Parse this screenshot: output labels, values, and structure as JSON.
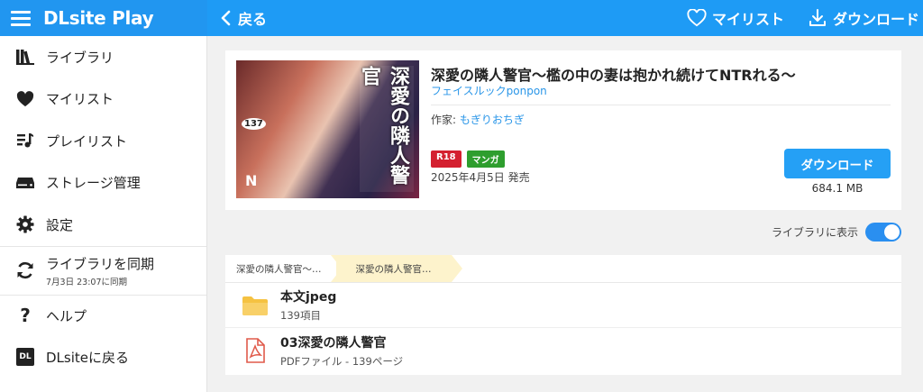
{
  "app": {
    "logo": "DLsite Play",
    "back_label": "戻る",
    "mylist_label": "マイリスト",
    "download_label": "ダウンロード"
  },
  "sidebar": {
    "items": [
      {
        "label": "ライブラリ",
        "icon": "library-icon"
      },
      {
        "label": "マイリスト",
        "icon": "heart-icon"
      },
      {
        "label": "プレイリスト",
        "icon": "playlist-icon"
      },
      {
        "label": "ストレージ管理",
        "icon": "storage-icon"
      },
      {
        "label": "設定",
        "icon": "gear-icon"
      }
    ],
    "sync": {
      "label": "ライブラリを同期",
      "sub": "7月3日 23:07に同期"
    },
    "help": "ヘルプ",
    "back_dlsite": "DLsiteに戻る",
    "back_dlsite_badge": "DL"
  },
  "work": {
    "title": "深愛の隣人警官〜檻の中の妻は抱かれ続けてNTRれる〜",
    "circle": "フェイスルックponpon",
    "author_label": "作家: ",
    "author": "もぎりおちぎ",
    "tags": [
      "R18",
      "マンガ"
    ],
    "release": "2025年4月5日 発売",
    "download_button": "ダウンロード",
    "size": "684.1 MB",
    "cover_text": [
      "深愛の隣人警官",
      "137",
      "N"
    ]
  },
  "library_toggle": {
    "label": "ライブラリに表示",
    "on": true
  },
  "files": {
    "breadcrumb": [
      "深愛の隣人警官〜…",
      "深愛の隣人警官…"
    ],
    "items": [
      {
        "name": "本文jpeg",
        "meta": "139項目",
        "icon": "folder-icon"
      },
      {
        "name": "03深愛の隣人警官",
        "meta": "PDFファイル - 139ページ",
        "icon": "pdf-icon"
      }
    ]
  },
  "colors": {
    "accent": "#1e9bf5",
    "r18": "#d42030",
    "genre": "#2e9e2e",
    "folder": "#f5c242",
    "pdf": "#e05a4a"
  }
}
